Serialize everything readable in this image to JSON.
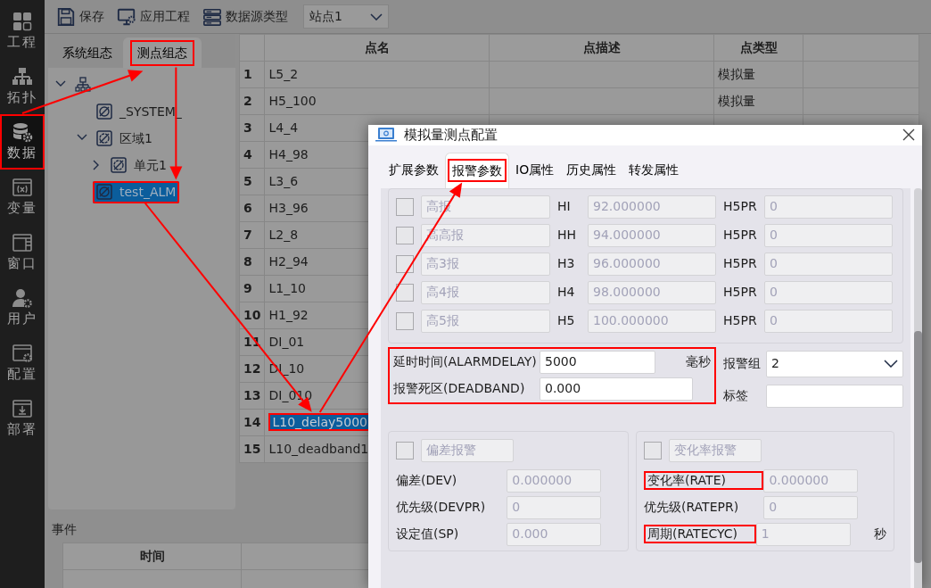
{
  "callout_arrows": true,
  "sidebar": {
    "items": [
      {
        "label": "工程",
        "selected": false,
        "highlighted": false
      },
      {
        "label": "拓扑",
        "selected": false,
        "highlighted": false
      },
      {
        "label": "数据",
        "selected": true,
        "highlighted": true
      },
      {
        "label": "变量",
        "selected": false,
        "highlighted": false
      },
      {
        "label": "窗口",
        "selected": false,
        "highlighted": false
      },
      {
        "label": "用户",
        "selected": false,
        "highlighted": false
      },
      {
        "label": "配置",
        "selected": false,
        "highlighted": false
      },
      {
        "label": "部署",
        "selected": false,
        "highlighted": false
      }
    ]
  },
  "toolbar": {
    "buttons": [
      {
        "label": "保存"
      },
      {
        "label": "应用工程"
      },
      {
        "label": "数据源类型"
      }
    ],
    "station_select": {
      "value": "站点1"
    }
  },
  "tree_panel": {
    "tabs": [
      {
        "label": "系统组态",
        "selected": false,
        "highlighted": false
      },
      {
        "label": "测点组态",
        "selected": true,
        "highlighted": true
      }
    ],
    "tree": [
      {
        "kind": "root",
        "expanded": true,
        "selected": false,
        "highlighted": false,
        "children": [
          {
            "kind": "leaf",
            "label": "_SYSTEM_",
            "selected": false,
            "highlighted": false
          },
          {
            "kind": "branch",
            "label": "区域1",
            "expanded": true,
            "selected": false,
            "highlighted": false,
            "children": [
              {
                "kind": "branch",
                "label": "单元1",
                "expanded": false,
                "selected": false,
                "highlighted": false
              }
            ]
          },
          {
            "kind": "leaf",
            "label": "test_ALM",
            "selected": true,
            "highlighted": true
          }
        ]
      }
    ]
  },
  "table": {
    "columns": [
      "点名",
      "点描述",
      "点类型"
    ],
    "rows": [
      {
        "index": "1",
        "name": "L5_2",
        "type": "模拟量",
        "selected": false,
        "highlighted": false
      },
      {
        "index": "2",
        "name": "H5_100",
        "type": "模拟量",
        "selected": false,
        "highlighted": false
      },
      {
        "index": "3",
        "name": "L4_4",
        "selected": false,
        "highlighted": false
      },
      {
        "index": "4",
        "name": "H4_98",
        "selected": false,
        "highlighted": false
      },
      {
        "index": "5",
        "name": "L3_6",
        "selected": false,
        "highlighted": false
      },
      {
        "index": "6",
        "name": "H3_96",
        "selected": false,
        "highlighted": false
      },
      {
        "index": "7",
        "name": "L2_8",
        "selected": false,
        "highlighted": false
      },
      {
        "index": "8",
        "name": "H2_94",
        "selected": false,
        "highlighted": false
      },
      {
        "index": "9",
        "name": "L1_10",
        "selected": false,
        "highlighted": false
      },
      {
        "index": "10",
        "name": "H1_92",
        "selected": false,
        "highlighted": false
      },
      {
        "index": "11",
        "name": "DI_01",
        "selected": false,
        "highlighted": false
      },
      {
        "index": "12",
        "name": "DI_10",
        "selected": false,
        "highlighted": false
      },
      {
        "index": "13",
        "name": "DI_010",
        "selected": false,
        "highlighted": false
      },
      {
        "index": "14",
        "name": "L10_delay5000",
        "selected": true,
        "highlighted": true
      },
      {
        "index": "15",
        "name": "L10_deadband1",
        "selected": false,
        "highlighted": false
      }
    ]
  },
  "events": {
    "title": "事件",
    "columns": [
      "时间"
    ]
  },
  "dialog": {
    "title": "模拟量测点配置",
    "tabs": [
      {
        "label": "扩展参数",
        "selected": false,
        "highlighted": false
      },
      {
        "label": "报警参数",
        "selected": true,
        "highlighted": true
      },
      {
        "label": "IO属性",
        "selected": false,
        "highlighted": false
      },
      {
        "label": "历史属性",
        "selected": false,
        "highlighted": false
      },
      {
        "label": "转发属性",
        "selected": false,
        "highlighted": false
      }
    ],
    "alarm_levels": [
      {
        "checked": false,
        "disabled": true,
        "name": "高报",
        "code": "HI",
        "value": "92.000000",
        "priority_label": "H5PR",
        "priority": "0"
      },
      {
        "checked": false,
        "disabled": true,
        "name": "高高报",
        "code": "HH",
        "value": "94.000000",
        "priority_label": "H5PR",
        "priority": "0"
      },
      {
        "checked": false,
        "disabled": true,
        "name": "高3报",
        "code": "H3",
        "value": "96.000000",
        "priority_label": "H5PR",
        "priority": "0"
      },
      {
        "checked": false,
        "disabled": true,
        "name": "高4报",
        "code": "H4",
        "value": "98.000000",
        "priority_label": "H5PR",
        "priority": "0"
      },
      {
        "checked": false,
        "disabled": true,
        "name": "高5报",
        "code": "H5",
        "value": "100.000000",
        "priority_label": "H5PR",
        "priority": "0"
      }
    ],
    "delay_group_highlighted": true,
    "delay": {
      "label": "延时时间(ALARMDELAY)",
      "value": "5000",
      "unit": "毫秒"
    },
    "deadband": {
      "label": "报警死区(DEADBAND)",
      "value": "0.000"
    },
    "alarm_group": {
      "label": "报警组",
      "value": "2"
    },
    "tag": {
      "label": "标签"
    },
    "deviation": {
      "checked": false,
      "name": "偏差报警",
      "fields": [
        {
          "label": "偏差(DEV)",
          "value": "0.000000",
          "disabled": true,
          "highlighted": false
        },
        {
          "label": "优先级(DEVPR)",
          "value": "0",
          "disabled": true,
          "highlighted": false
        },
        {
          "label": "设定值(SP)",
          "value": "0.000",
          "disabled": true,
          "highlighted": false
        }
      ]
    },
    "rate": {
      "checked": false,
      "name": "变化率报警",
      "fields": [
        {
          "label": "变化率(RATE)",
          "value": "0.000000",
          "disabled": true,
          "highlighted": true
        },
        {
          "label": "优先级(RATEPR)",
          "value": "0",
          "disabled": true,
          "highlighted": false
        },
        {
          "label": "周期(RATECYC)",
          "value": "1",
          "unit": "秒",
          "disabled": true,
          "highlighted": true
        }
      ]
    }
  }
}
